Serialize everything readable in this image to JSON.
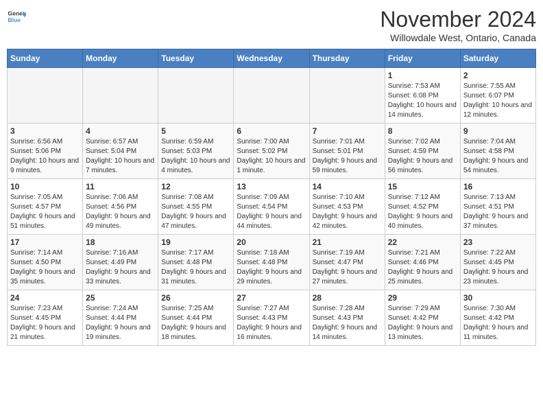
{
  "header": {
    "logo_general": "General",
    "logo_blue": "Blue",
    "month_title": "November 2024",
    "location": "Willowdale West, Ontario, Canada"
  },
  "weekdays": [
    "Sunday",
    "Monday",
    "Tuesday",
    "Wednesday",
    "Thursday",
    "Friday",
    "Saturday"
  ],
  "weeks": [
    [
      {
        "day": "",
        "info": ""
      },
      {
        "day": "",
        "info": ""
      },
      {
        "day": "",
        "info": ""
      },
      {
        "day": "",
        "info": ""
      },
      {
        "day": "",
        "info": ""
      },
      {
        "day": "1",
        "info": "Sunrise: 7:53 AM\nSunset: 6:08 PM\nDaylight: 10 hours and 14 minutes."
      },
      {
        "day": "2",
        "info": "Sunrise: 7:55 AM\nSunset: 6:07 PM\nDaylight: 10 hours and 12 minutes."
      }
    ],
    [
      {
        "day": "3",
        "info": "Sunrise: 6:56 AM\nSunset: 5:06 PM\nDaylight: 10 hours and 9 minutes."
      },
      {
        "day": "4",
        "info": "Sunrise: 6:57 AM\nSunset: 5:04 PM\nDaylight: 10 hours and 7 minutes."
      },
      {
        "day": "5",
        "info": "Sunrise: 6:59 AM\nSunset: 5:03 PM\nDaylight: 10 hours and 4 minutes."
      },
      {
        "day": "6",
        "info": "Sunrise: 7:00 AM\nSunset: 5:02 PM\nDaylight: 10 hours and 1 minute."
      },
      {
        "day": "7",
        "info": "Sunrise: 7:01 AM\nSunset: 5:01 PM\nDaylight: 9 hours and 59 minutes."
      },
      {
        "day": "8",
        "info": "Sunrise: 7:02 AM\nSunset: 4:59 PM\nDaylight: 9 hours and 56 minutes."
      },
      {
        "day": "9",
        "info": "Sunrise: 7:04 AM\nSunset: 4:58 PM\nDaylight: 9 hours and 54 minutes."
      }
    ],
    [
      {
        "day": "10",
        "info": "Sunrise: 7:05 AM\nSunset: 4:57 PM\nDaylight: 9 hours and 51 minutes."
      },
      {
        "day": "11",
        "info": "Sunrise: 7:06 AM\nSunset: 4:56 PM\nDaylight: 9 hours and 49 minutes."
      },
      {
        "day": "12",
        "info": "Sunrise: 7:08 AM\nSunset: 4:55 PM\nDaylight: 9 hours and 47 minutes."
      },
      {
        "day": "13",
        "info": "Sunrise: 7:09 AM\nSunset: 4:54 PM\nDaylight: 9 hours and 44 minutes."
      },
      {
        "day": "14",
        "info": "Sunrise: 7:10 AM\nSunset: 4:53 PM\nDaylight: 9 hours and 42 minutes."
      },
      {
        "day": "15",
        "info": "Sunrise: 7:12 AM\nSunset: 4:52 PM\nDaylight: 9 hours and 40 minutes."
      },
      {
        "day": "16",
        "info": "Sunrise: 7:13 AM\nSunset: 4:51 PM\nDaylight: 9 hours and 37 minutes."
      }
    ],
    [
      {
        "day": "17",
        "info": "Sunrise: 7:14 AM\nSunset: 4:50 PM\nDaylight: 9 hours and 35 minutes."
      },
      {
        "day": "18",
        "info": "Sunrise: 7:16 AM\nSunset: 4:49 PM\nDaylight: 9 hours and 33 minutes."
      },
      {
        "day": "19",
        "info": "Sunrise: 7:17 AM\nSunset: 4:48 PM\nDaylight: 9 hours and 31 minutes."
      },
      {
        "day": "20",
        "info": "Sunrise: 7:18 AM\nSunset: 4:48 PM\nDaylight: 9 hours and 29 minutes."
      },
      {
        "day": "21",
        "info": "Sunrise: 7:19 AM\nSunset: 4:47 PM\nDaylight: 9 hours and 27 minutes."
      },
      {
        "day": "22",
        "info": "Sunrise: 7:21 AM\nSunset: 4:46 PM\nDaylight: 9 hours and 25 minutes."
      },
      {
        "day": "23",
        "info": "Sunrise: 7:22 AM\nSunset: 4:45 PM\nDaylight: 9 hours and 23 minutes."
      }
    ],
    [
      {
        "day": "24",
        "info": "Sunrise: 7:23 AM\nSunset: 4:45 PM\nDaylight: 9 hours and 21 minutes."
      },
      {
        "day": "25",
        "info": "Sunrise: 7:24 AM\nSunset: 4:44 PM\nDaylight: 9 hours and 19 minutes."
      },
      {
        "day": "26",
        "info": "Sunrise: 7:25 AM\nSunset: 4:44 PM\nDaylight: 9 hours and 18 minutes."
      },
      {
        "day": "27",
        "info": "Sunrise: 7:27 AM\nSunset: 4:43 PM\nDaylight: 9 hours and 16 minutes."
      },
      {
        "day": "28",
        "info": "Sunrise: 7:28 AM\nSunset: 4:43 PM\nDaylight: 9 hours and 14 minutes."
      },
      {
        "day": "29",
        "info": "Sunrise: 7:29 AM\nSunset: 4:42 PM\nDaylight: 9 hours and 13 minutes."
      },
      {
        "day": "30",
        "info": "Sunrise: 7:30 AM\nSunset: 4:42 PM\nDaylight: 9 hours and 11 minutes."
      }
    ]
  ]
}
